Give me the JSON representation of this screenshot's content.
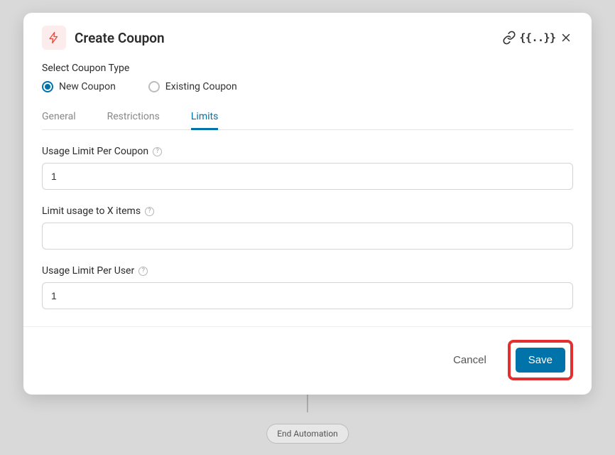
{
  "header": {
    "title": "Create Coupon"
  },
  "couponTypeLabel": "Select Coupon Type",
  "radios": {
    "new": "New Coupon",
    "existing": "Existing Coupon"
  },
  "tabs": {
    "general": "General",
    "restrictions": "Restrictions",
    "limits": "Limits"
  },
  "fields": {
    "usageLimitPerCoupon": {
      "label": "Usage Limit Per Coupon",
      "value": "1"
    },
    "limitXItems": {
      "label": "Limit usage to X items",
      "value": ""
    },
    "usageLimitPerUser": {
      "label": "Usage Limit Per User",
      "value": "1"
    }
  },
  "footer": {
    "cancel": "Cancel",
    "save": "Save"
  },
  "automation": {
    "endLabel": "End Automation"
  }
}
